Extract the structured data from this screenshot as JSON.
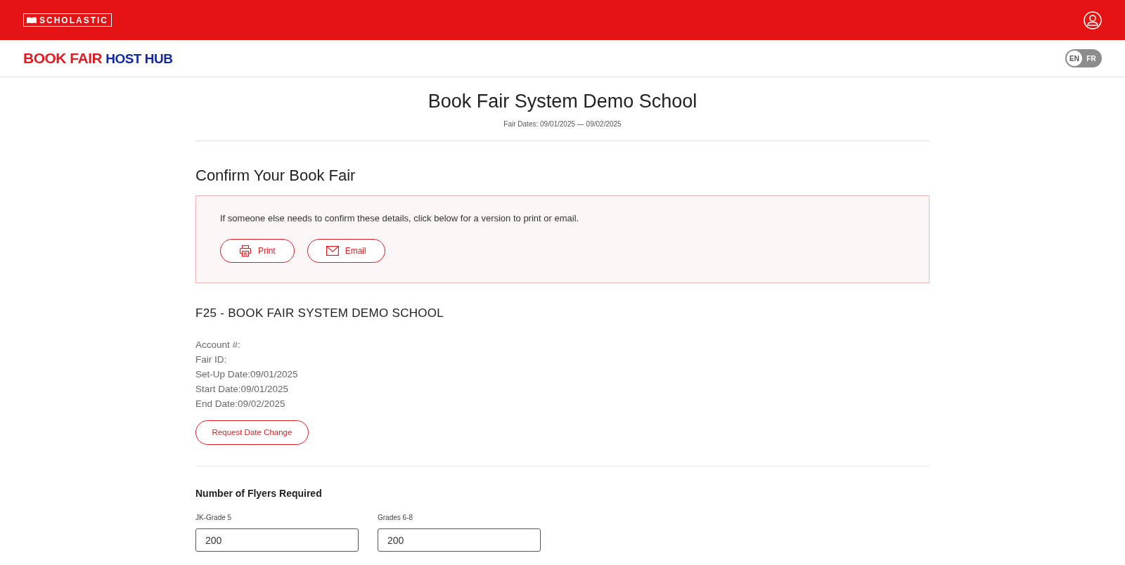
{
  "brand": {
    "publisher": "SCHOLASTIC",
    "title_part1": "BOOK FAIR",
    "title_part2": "HOST HUB"
  },
  "languages": [
    {
      "label": "EN",
      "selected": true
    },
    {
      "label": "FR",
      "selected": false
    }
  ],
  "school": {
    "name": "Book Fair System Demo School",
    "fair_dates": "Fair Dates: 09/01/2025 — 09/02/2025"
  },
  "confirm": {
    "heading": "Confirm Your Book Fair",
    "notice": "If someone else needs to confirm these details, click below for a version to print or email.",
    "buttons": [
      {
        "kind": "print",
        "label": "Print"
      },
      {
        "kind": "email",
        "label": "Email"
      }
    ]
  },
  "fair": {
    "heading": "F25 - BOOK FAIR SYSTEM DEMO SCHOOL",
    "details": [
      "Account #:",
      "Fair ID:",
      "Set-Up Date:09/01/2025",
      "Start Date:09/01/2025",
      "End Date:09/02/2025"
    ],
    "request_button": "Request Date Change"
  },
  "flyers": {
    "heading": "Number of Flyers Required",
    "fields": [
      {
        "label": "JK-Grade 5",
        "value": "200"
      },
      {
        "label": "Grades 6-8",
        "value": "200"
      }
    ]
  }
}
